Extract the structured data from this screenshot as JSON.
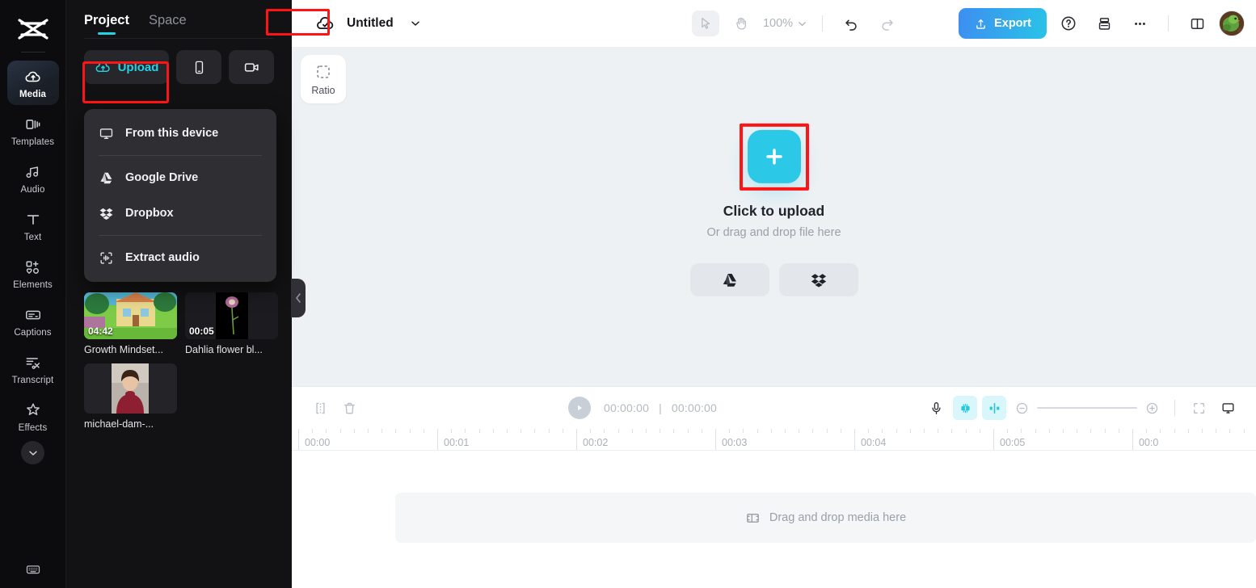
{
  "rail": {
    "logo_icon": "capcut-logo-icon",
    "items": [
      {
        "label": "Media",
        "icon": "cloud-upload-icon",
        "active": true
      },
      {
        "label": "Templates",
        "icon": "templates-icon",
        "active": false
      },
      {
        "label": "Audio",
        "icon": "music-note-icon",
        "active": false
      },
      {
        "label": "Text",
        "icon": "text-t-icon",
        "active": false
      },
      {
        "label": "Elements",
        "icon": "elements-icon",
        "active": false
      },
      {
        "label": "Captions",
        "icon": "captions-icon",
        "active": false
      },
      {
        "label": "Transcript",
        "icon": "transcript-icon",
        "active": false
      },
      {
        "label": "Effects",
        "icon": "sparkle-star-icon",
        "active": false
      }
    ],
    "expand_icon": "chevron-down-icon",
    "keyboard_icon": "keyboard-icon"
  },
  "panel": {
    "tabs": [
      {
        "label": "Project",
        "active": true
      },
      {
        "label": "Space",
        "active": false
      }
    ],
    "upload": {
      "label": "Upload",
      "icon": "cloud-upload-icon"
    },
    "device_button_icon": "phone-icon",
    "record_button_icon": "video-camera-icon",
    "dropdown": {
      "items": [
        {
          "label": "From this device",
          "icon": "monitor-icon"
        },
        {
          "label": "Google Drive",
          "icon": "google-drive-icon"
        },
        {
          "label": "Dropbox",
          "icon": "dropbox-icon"
        },
        {
          "label": "Extract audio",
          "icon": "extract-audio-icon"
        }
      ]
    },
    "media": [
      {
        "name": "Growth Mindset...",
        "duration": "04:42"
      },
      {
        "name": "Dahlia flower bl...",
        "duration": "00:05"
      },
      {
        "name": "michael-dam-...",
        "duration": ""
      }
    ],
    "collapse_icon": "chevron-left-icon"
  },
  "topbar": {
    "cloud_icon": "cloud-check-icon",
    "project_title": "Untitled",
    "title_chevron_icon": "chevron-down-icon",
    "cursor_tool_icon": "cursor-arrow-icon",
    "hand_tool_icon": "hand-icon",
    "zoom_level": "100%",
    "zoom_chevron_icon": "chevron-down-icon",
    "undo_icon": "undo-icon",
    "redo_icon": "redo-icon",
    "export_label": "Export",
    "export_icon": "export-upload-icon",
    "help_icon": "question-circle-icon",
    "layers_icon": "layers-icon",
    "more_icon": "ellipsis-icon",
    "panel_toggle_icon": "split-panel-icon",
    "avatar_icon": "user-avatar"
  },
  "canvas": {
    "ratio_label": "Ratio",
    "ratio_icon": "dashed-square-icon",
    "plus_icon": "plus-icon",
    "upload_title": "Click to upload",
    "upload_subtitle": "Or drag and drop file here",
    "cloud_buttons": [
      {
        "icon": "google-drive-icon"
      },
      {
        "icon": "dropbox-icon"
      }
    ]
  },
  "timeline": {
    "split_icon": "split-clip-icon",
    "delete_icon": "trash-icon",
    "play_icon": "play-icon",
    "current_time": "00:00:00",
    "total_time": "00:00:00",
    "time_separator": "|",
    "mic_icon": "microphone-icon",
    "mixer_icon": "audio-mixer-icon",
    "waveform_icon": "waveform-icon",
    "zoom_out_icon": "minus-circle-icon",
    "zoom_in_icon": "plus-circle-icon",
    "fit_icon": "fit-screen-icon",
    "preview_icon": "monitor-preview-icon",
    "ruler_labels": [
      "00:00",
      "00:01",
      "00:02",
      "00:03",
      "00:04",
      "00:05",
      "00:0"
    ],
    "drop_label": "Drag and drop media here",
    "drop_icon": "filmstrip-icon"
  },
  "highlights": {
    "color": "#ff1414",
    "targets": [
      "space-tab",
      "upload-button",
      "plus-upload-button"
    ]
  }
}
